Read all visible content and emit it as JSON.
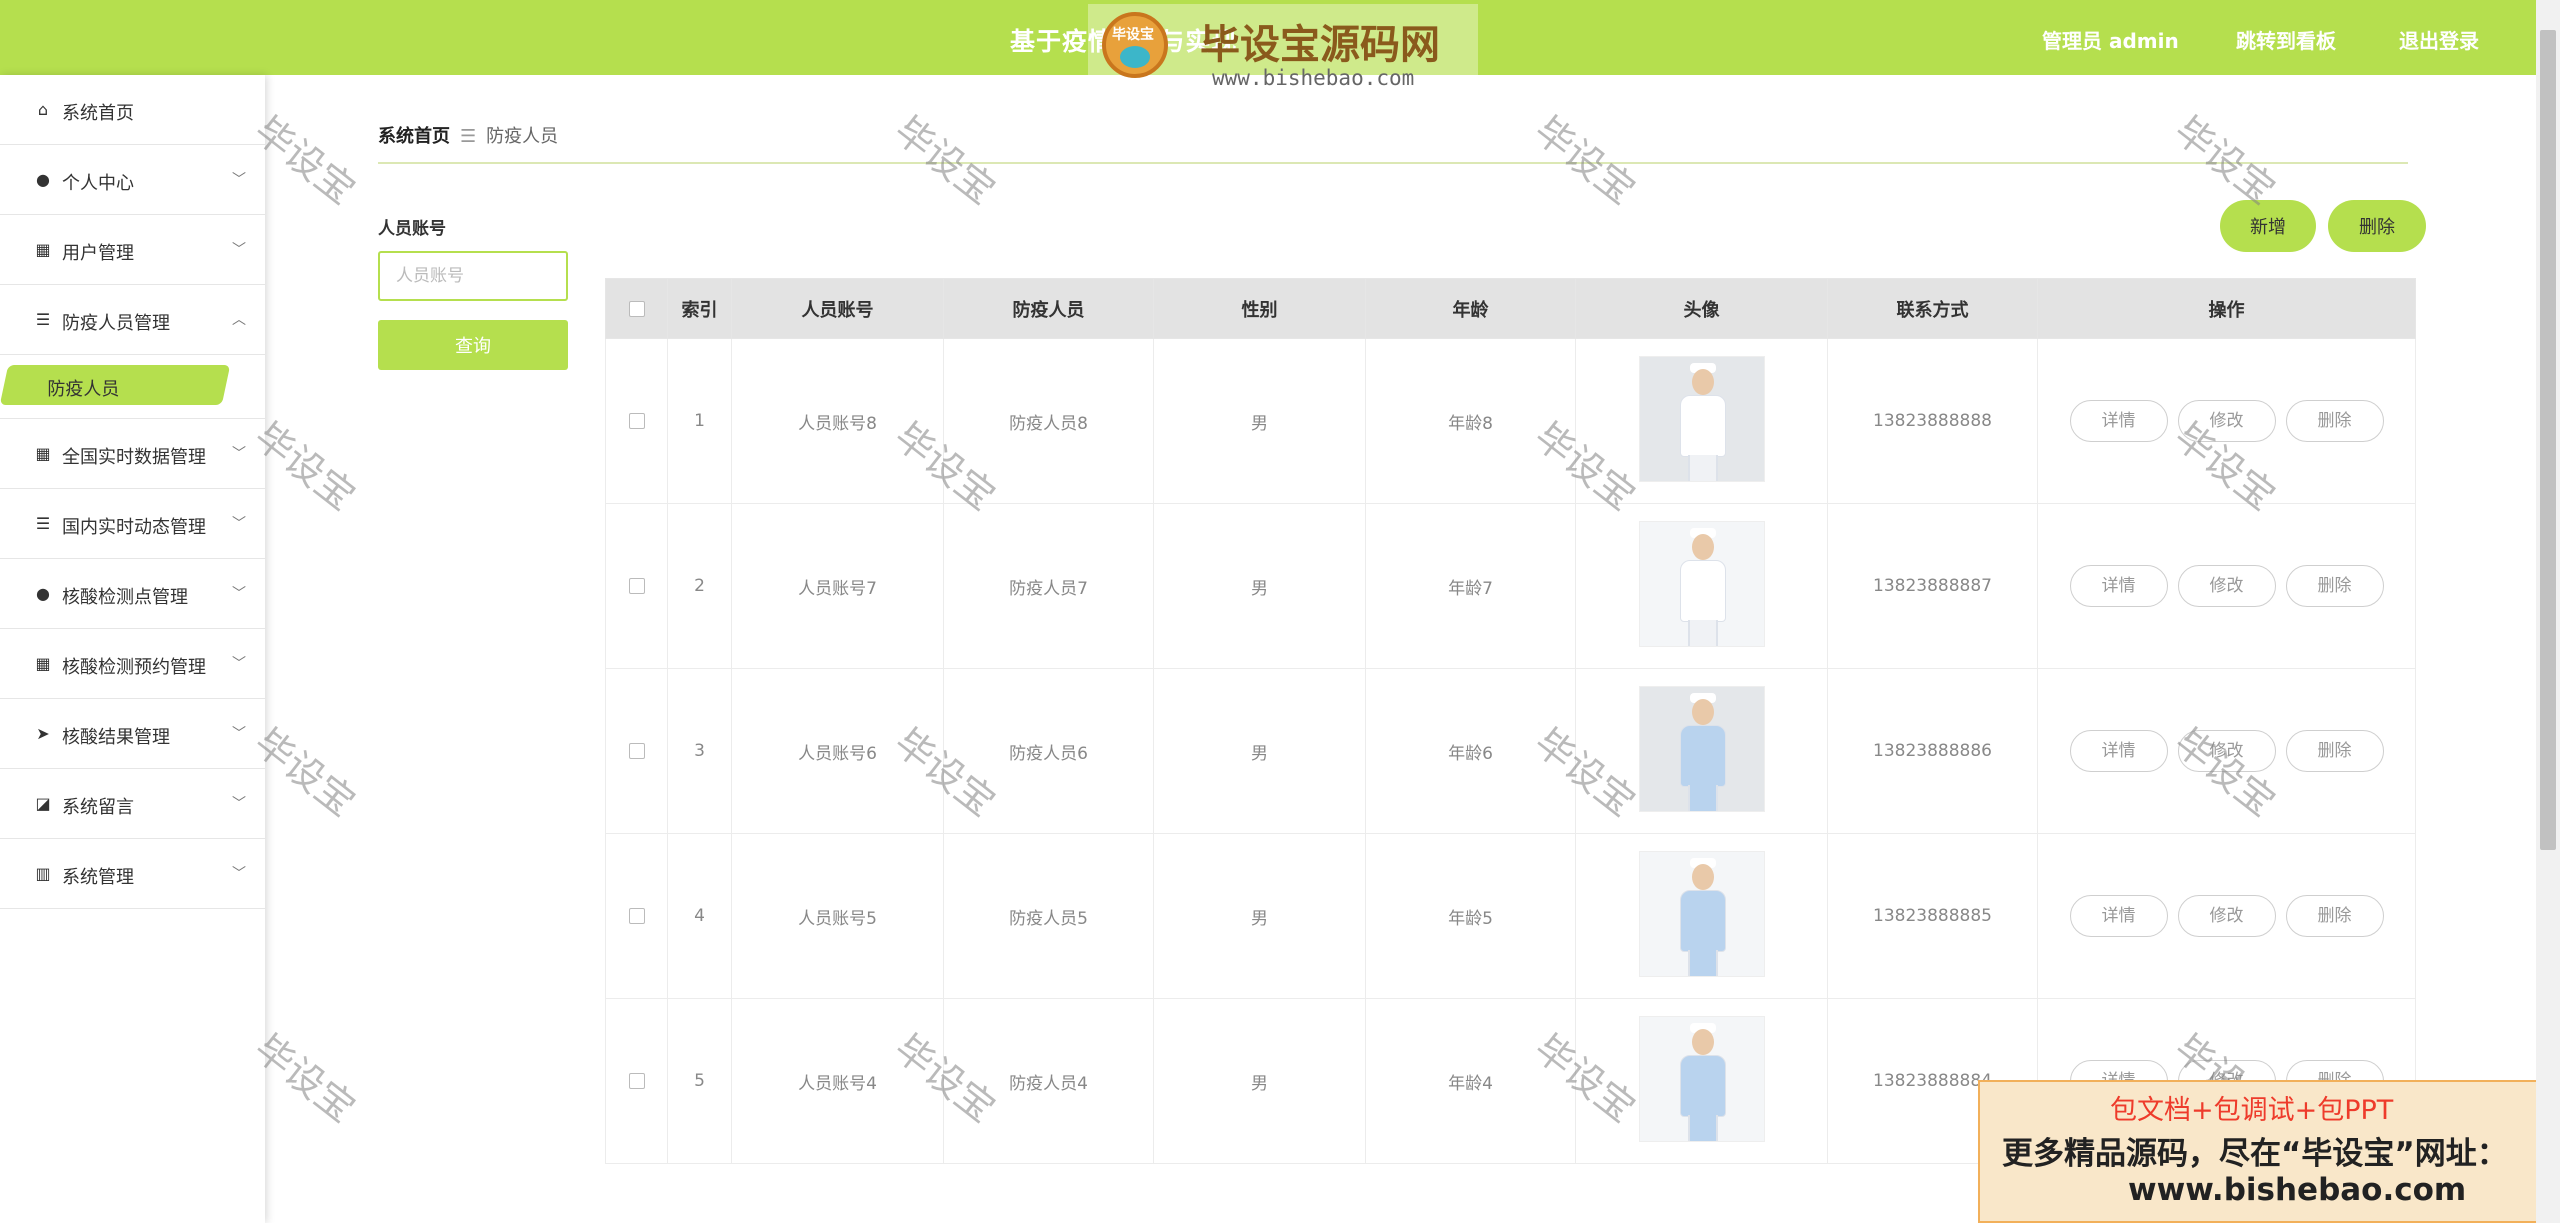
{
  "header": {
    "title": "基于疫情 … 与实现",
    "user_label": "管理员 admin",
    "dashboard_link": "跳转到看板",
    "logout_link": "退出登录"
  },
  "logo": {
    "badge": "毕设宝",
    "name": "毕设宝源码网",
    "url": "www.bishebao.com"
  },
  "sidebar": {
    "items": [
      {
        "label": "系统首页",
        "icon": "home-icon"
      },
      {
        "label": "个人中心",
        "icon": "person-icon"
      },
      {
        "label": "用户管理",
        "icon": "grid-icon"
      },
      {
        "label": "防疫人员管理",
        "icon": "list-icon",
        "submenu": [
          "防疫人员"
        ]
      },
      {
        "label": "全国实时数据管理",
        "icon": "grid-icon"
      },
      {
        "label": "国内实时动态管理",
        "icon": "list-icon"
      },
      {
        "label": "核酸检测点管理",
        "icon": "person-icon"
      },
      {
        "label": "核酸检测预约管理",
        "icon": "grid-icon"
      },
      {
        "label": "核酸结果管理",
        "icon": "send-icon"
      },
      {
        "label": "系统留言",
        "icon": "chart-icon"
      },
      {
        "label": "系统管理",
        "icon": "bar-icon"
      }
    ]
  },
  "breadcrumb": {
    "home": "系统首页",
    "current": "防疫人员"
  },
  "search": {
    "label": "人员账号",
    "placeholder": "人员账号",
    "button": "查询"
  },
  "actions": {
    "add": "新增",
    "delete": "删除"
  },
  "table": {
    "columns": [
      "索引",
      "人员账号",
      "防疫人员",
      "性别",
      "年龄",
      "头像",
      "联系方式",
      "操作"
    ],
    "rows": [
      {
        "index": "1",
        "account": "人员账号8",
        "name": "防疫人员8",
        "gender": "男",
        "age": "年龄8",
        "phone": "13823888888"
      },
      {
        "index": "2",
        "account": "人员账号7",
        "name": "防疫人员7",
        "gender": "男",
        "age": "年龄7",
        "phone": "13823888887"
      },
      {
        "index": "3",
        "account": "人员账号6",
        "name": "防疫人员6",
        "gender": "男",
        "age": "年龄6",
        "phone": "13823888886"
      },
      {
        "index": "4",
        "account": "人员账号5",
        "name": "防疫人员5",
        "gender": "男",
        "age": "年龄5",
        "phone": "13823888885"
      },
      {
        "index": "5",
        "account": "人员账号4",
        "name": "防疫人员4",
        "gender": "男",
        "age": "年龄4",
        "phone": "13823888884"
      }
    ],
    "row_actions": {
      "detail": "详情",
      "edit": "修改",
      "delete": "删除"
    }
  },
  "watermark": "毕设宝",
  "promo": {
    "line1": "包文档+包调试+包PPT",
    "line2": "更多精品源码，尽在“毕设宝”网址：",
    "line3": "www.bishebao.com"
  },
  "colors": {
    "accent": "#b5df4e",
    "header_text": "#ffffff",
    "promo_red": "#ee3b2b"
  }
}
